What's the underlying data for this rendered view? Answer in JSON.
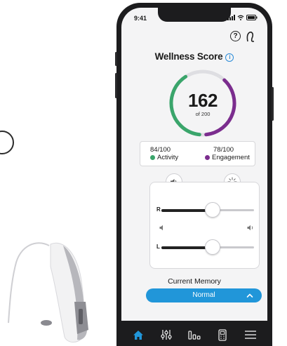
{
  "status": {
    "time": "9:41"
  },
  "header": {
    "title": "Wellness Score"
  },
  "score": {
    "value": "162",
    "of_label": "of 200",
    "current": 162,
    "max": 200
  },
  "metrics": {
    "activity": {
      "value": "84/100",
      "label": "Activity",
      "color": "#3aa56b",
      "fraction": 0.84
    },
    "engagement": {
      "value": "78/100",
      "label": "Engagement",
      "color": "#7b2d8e",
      "fraction": 0.78
    }
  },
  "volume": {
    "right": {
      "label": "R",
      "level": 0.55
    },
    "left": {
      "label": "L",
      "level": 0.55
    }
  },
  "memory": {
    "label": "Current Memory",
    "selected": "Normal"
  },
  "tabs": [
    {
      "name": "home",
      "active": true
    },
    {
      "name": "adjust"
    },
    {
      "name": "stats"
    },
    {
      "name": "remote"
    },
    {
      "name": "menu"
    }
  ],
  "colors": {
    "accent": "#2196d9",
    "activity": "#3aa56b",
    "engagement": "#7b2d8e"
  }
}
